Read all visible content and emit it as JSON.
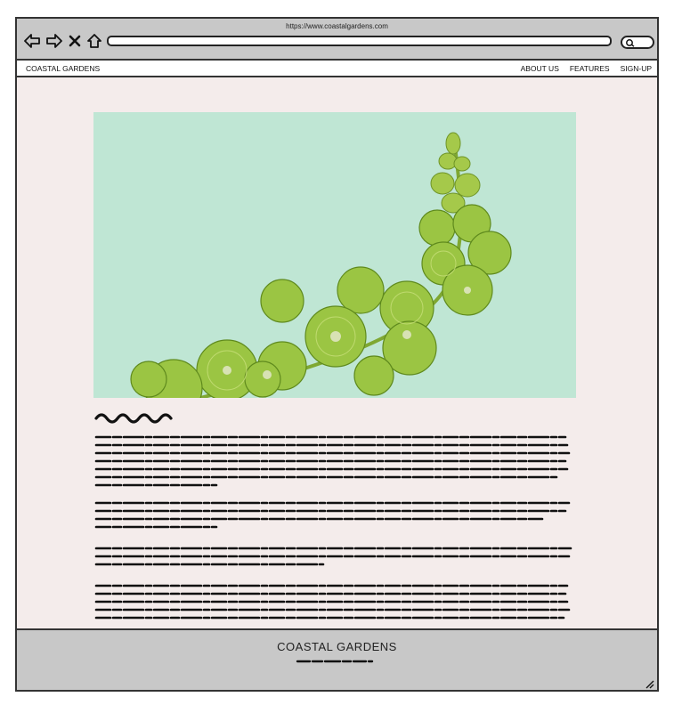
{
  "browser": {
    "url": "https://www.coastalgardens.com",
    "icons": [
      "back-arrow-icon",
      "forward-arrow-icon",
      "close-x-icon",
      "home-icon",
      "search-icon"
    ]
  },
  "nav": {
    "brand": "COASTAL GARDENS",
    "links": [
      "ABOUT US",
      "FEATURES",
      "SIGN-UP"
    ]
  },
  "hero": {
    "image": "Bells of Ireland flower stem",
    "background_color": "#bfe6d4"
  },
  "footer": {
    "title": "COASTAL GARDENS"
  },
  "colors": {
    "page_background": "#f4eceb",
    "chrome_gray": "#c8c8c8",
    "outline": "#333333"
  }
}
